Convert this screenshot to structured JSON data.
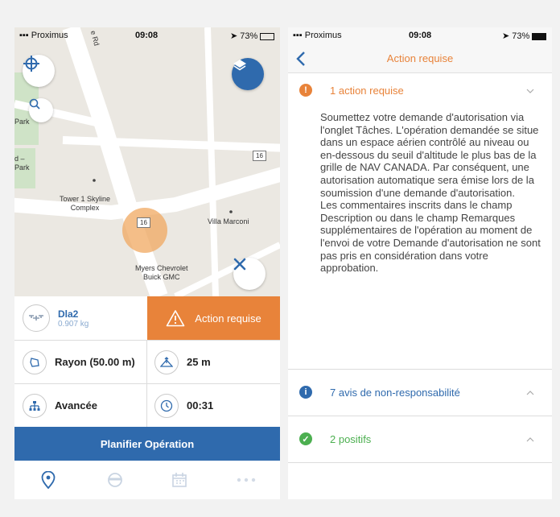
{
  "left_screen": {
    "status": {
      "carrier": "Proximus",
      "time": "09:08",
      "battery": "73%"
    },
    "map": {
      "street_label": "e Rd",
      "labels": {
        "park_1": "Park",
        "park_2": "d –\nPark",
        "tower": "Tower 1 Skyline\nComplex",
        "villa": "Villa Marconi",
        "myers": "Myers Chevrolet\nBuick GMC",
        "route16_a": "16",
        "route16_b": "16"
      }
    },
    "drone": {
      "name": "Dla2",
      "weight": "0.907 kg"
    },
    "action_button": "Action requise",
    "radius": "Rayon (50.00 m)",
    "altitude": "25 m",
    "mode": "Avancée",
    "duration": "00:31",
    "plan_button": "Planifier Opération",
    "icons": {
      "locate": "crosshair-icon",
      "search": "search-icon",
      "layers": "layers-icon",
      "close": "close-icon",
      "drone": "drone-icon",
      "warning": "warning-icon",
      "radius": "area-icon",
      "altitude": "altitude-icon",
      "mode": "hierarchy-icon",
      "duration": "clock-icon",
      "tabs": [
        "map-pin-icon",
        "pilot-icon",
        "calendar-icon",
        "more-icon"
      ]
    }
  },
  "right_screen": {
    "status": {
      "carrier": "Proximus",
      "time": "09:08",
      "battery": "73%"
    },
    "title": "Action requise",
    "sections": [
      {
        "title": "1 action requise",
        "color": "#e8833a",
        "icon": "!",
        "body": "Soumettez votre demande d'autorisation via l'onglet Tâches. L'opération demandée se situe dans un espace aérien contrôlé au niveau ou en-dessous du seuil d'altitude le plus bas de la grille de NAV CANADA. Par conséquent, une autorisation automatique sera émise lors de la soumission d'une demande d'autorisation.\nLes commentaires inscrits dans le champ Description ou dans le champ Remarques supplémentaires de l'opération au moment de l'envoi de votre Demande d'autorisation ne sont pas pris en considération dans votre approbation."
      },
      {
        "title": "7 avis de non-responsabilité",
        "color": "#2f6aad",
        "icon": "i"
      },
      {
        "title": "2 positifs",
        "color": "#4caf50",
        "icon": "✓"
      }
    ]
  },
  "colors": {
    "accent": "#e8833a",
    "primary": "#2f6aad",
    "success": "#4caf50"
  }
}
